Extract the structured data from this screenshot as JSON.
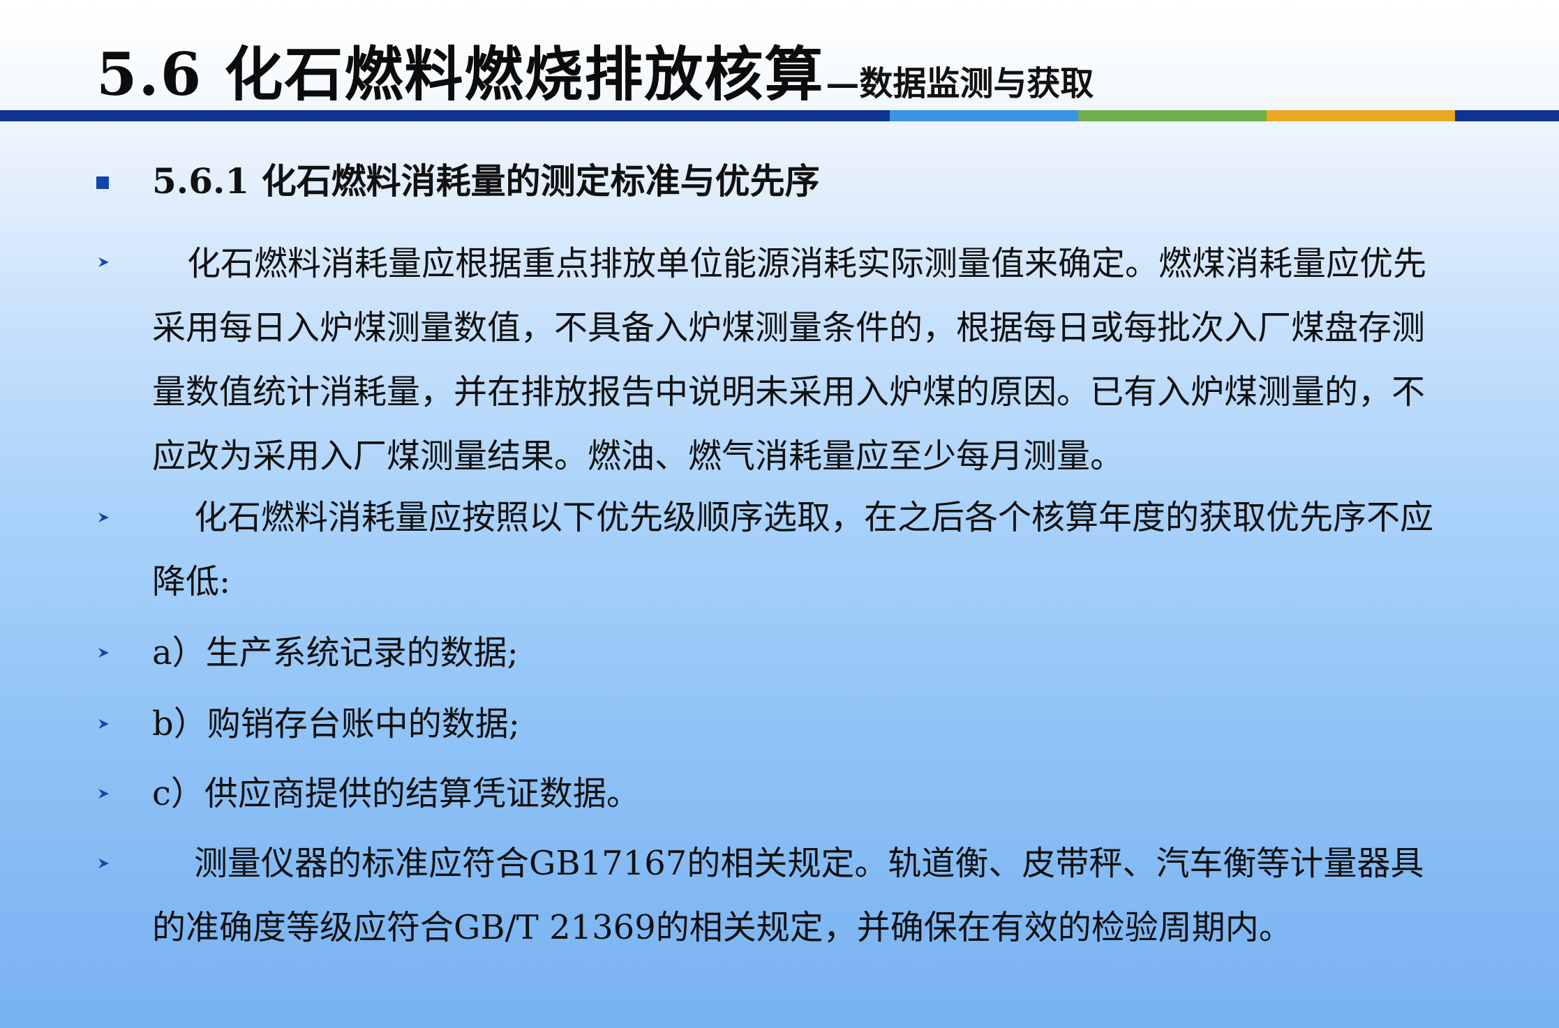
{
  "slide": {
    "title": "5.6 化石燃料燃烧排放核算",
    "subtitle": "—数据监测与获取",
    "stripe_colors": [
      "#0e3391",
      "#3b93e6",
      "#6fae4e",
      "#eaa724",
      "#0e3391"
    ]
  },
  "section": {
    "heading": "5.6.1 化石燃料消耗量的测定标准与优先序",
    "bullet_color": "#1147a8"
  },
  "items": [
    {
      "text": "化石燃料消耗量应根据重点排放单位能源消耗实际测量值来确定。燃煤消耗量应优先采用每日入炉煤测量数值，不具备入炉煤测量条件的，根据每日或每批次入厂煤盘存测量数值统计消耗量，并在排放报告中说明未采用入炉煤的原因。已有入炉煤测量的，不应改为采用入厂煤测量结果。燃油、燃气消耗量应至少每月测量。"
    },
    {
      "text": "化石燃料消耗量应按照以下优先级顺序选取，在之后各个核算年度的获取优先序不应降低:"
    },
    {
      "text": "a）生产系统记录的数据;"
    },
    {
      "text": "b）购销存台账中的数据;"
    },
    {
      "text": "c）供应商提供的结算凭证数据。"
    },
    {
      "text": "测量仪器的标准应符合GB17167的相关规定。轨道衡、皮带秤、汽车衡等计量器具的准确度等级应符合GB/T 21369的相关规定，并确保在有效的检验周期内。"
    }
  ],
  "icons": {
    "square_bullet": "square-bullet-icon",
    "item_bullet": "arrow-bullet-icon"
  }
}
